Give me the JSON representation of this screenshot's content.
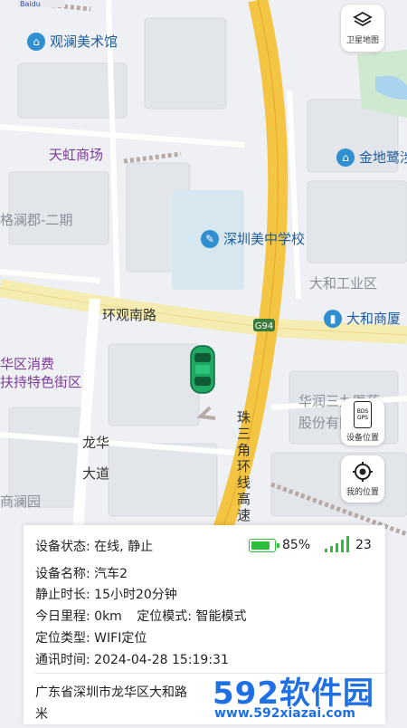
{
  "map": {
    "top_left_logo": "Baidu",
    "pois": [
      {
        "name": "观澜美术馆"
      },
      {
        "name": "天虹商场"
      },
      {
        "name": "金地鹭涉"
      },
      {
        "name": "格澜郡-二期"
      },
      {
        "name": "深圳美中学校"
      },
      {
        "name": "大和工业区"
      },
      {
        "name": "大和商厦"
      },
      {
        "name": "华区消费"
      },
      {
        "name": "扶持特色街区"
      },
      {
        "name": "华润三九医药"
      },
      {
        "name": "股份有限公司"
      },
      {
        "name": "商澜园"
      }
    ],
    "roads": {
      "huanguan": "环观南路",
      "g94": "G94",
      "longhua_1": "龙华",
      "longhua_2": "大道",
      "zhusanjiao": "珠三角环线高速"
    }
  },
  "controls": {
    "satellite_label": "卫星地图",
    "device_location_label": "设备位置",
    "device_location_icon_text": "BDS GPS",
    "my_location_label": "我的位置"
  },
  "panel": {
    "status_label": "设备状态:",
    "status_value": "在线, 静止",
    "battery_text": "85%",
    "battery_level": 0.85,
    "signal_text": "23",
    "device_name_label": "设备名称:",
    "device_name_value": "汽车2",
    "static_label": "静止时长:",
    "static_value": "15小时20分钟",
    "mileage_label": "今日里程:",
    "mileage_value": "0km",
    "mode_label": "定位模式:",
    "mode_value": "智能模式",
    "loc_type_label": "定位类型:",
    "loc_type_value": "WIFI定位",
    "comm_label": "通讯时间:",
    "comm_value": "2024-04-28 15:19:31",
    "address_line1": "广东省深圳市龙华区大和路",
    "address_line2": "米"
  },
  "watermark": {
    "big": "592软件园",
    "url": "www.592xiazai.com"
  },
  "colors": {
    "highway": "#f4c542",
    "main_road": "#f5ecb2",
    "car": "#1fa865",
    "battery": "#2dbe3c",
    "signal": "#2dbe3c",
    "watermark_blue": "#1f6fe5"
  }
}
